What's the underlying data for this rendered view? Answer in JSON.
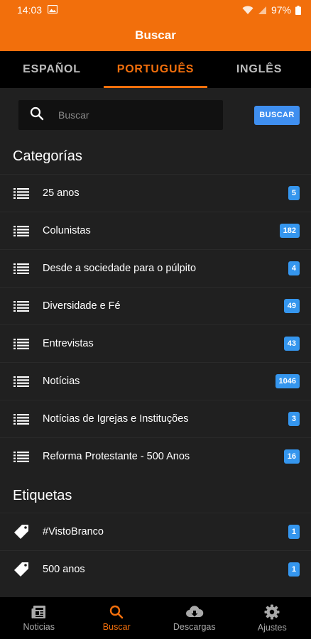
{
  "status": {
    "time": "14:03",
    "battery": "97%"
  },
  "app_bar": {
    "title": "Buscar"
  },
  "tabs": [
    {
      "label": "ESPAÑOL"
    },
    {
      "label": "PORTUGUÊS"
    },
    {
      "label": "INGLÊS"
    }
  ],
  "search": {
    "placeholder": "Buscar",
    "value": "",
    "button_label": "BUSCAR"
  },
  "categories": {
    "title": "Categorías",
    "items": [
      {
        "label": "25 anos",
        "count": "5"
      },
      {
        "label": "Colunistas",
        "count": "182"
      },
      {
        "label": "Desde a sociedade para o púlpito",
        "count": "4"
      },
      {
        "label": "Diversidade e Fé",
        "count": "49"
      },
      {
        "label": "Entrevistas",
        "count": "43"
      },
      {
        "label": "Notícias",
        "count": "1046"
      },
      {
        "label": "Notícias de Igrejas e Instituções",
        "count": "3"
      },
      {
        "label": "Reforma Protestante - 500 Anos",
        "count": "16"
      }
    ]
  },
  "tags": {
    "title": "Etiquetas",
    "items": [
      {
        "label": "#VistoBranco",
        "count": "1"
      },
      {
        "label": "500 anos",
        "count": "1"
      }
    ]
  },
  "bottom_nav": [
    {
      "label": "Noticias",
      "icon": "newspaper-icon"
    },
    {
      "label": "Buscar",
      "icon": "search-icon"
    },
    {
      "label": "Descargas",
      "icon": "cloud-download-icon"
    },
    {
      "label": "Ajustes",
      "icon": "gear-icon"
    }
  ],
  "colors": {
    "accent": "#f26f0c",
    "badge": "#3596ee",
    "button": "#3f8ff0",
    "background": "#202020"
  }
}
